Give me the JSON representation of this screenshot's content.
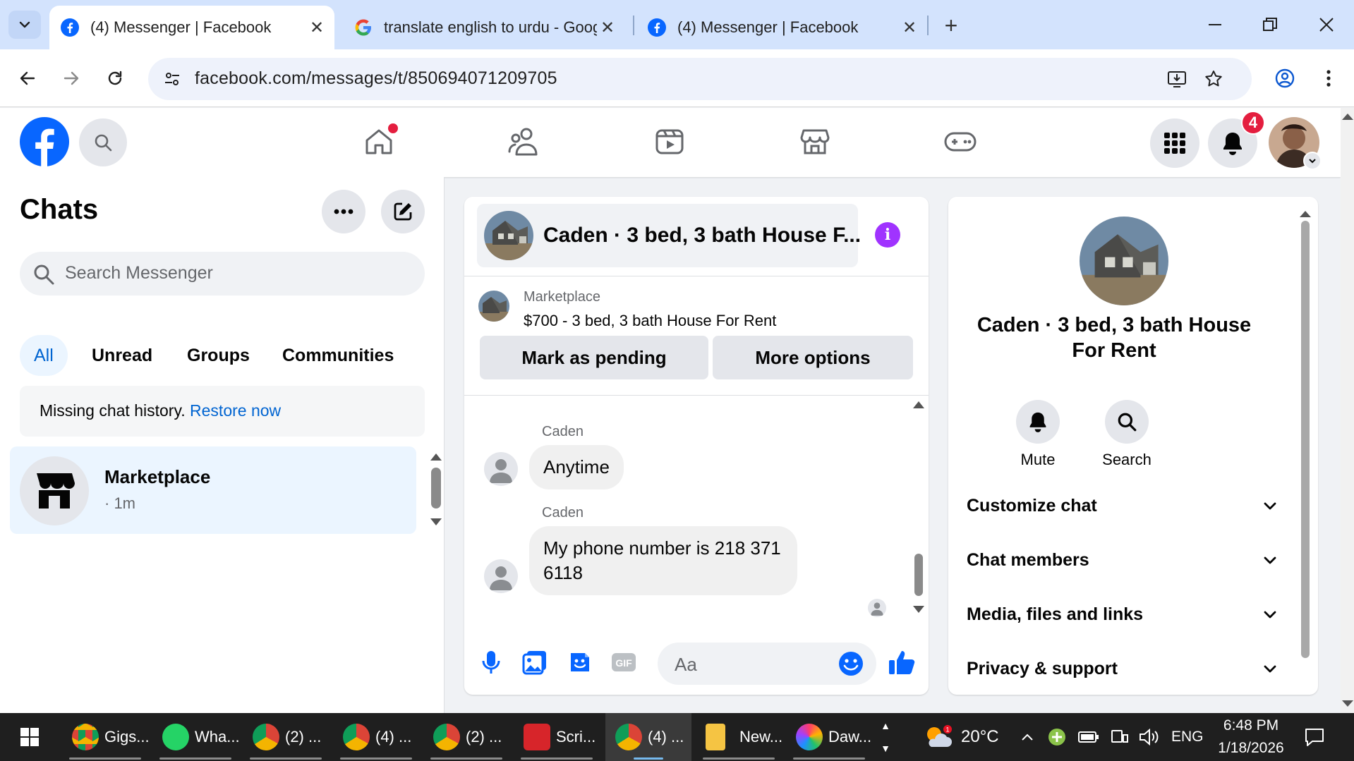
{
  "browser": {
    "tabs": [
      {
        "title": "(4) Messenger | Facebook",
        "favicon": "facebook-icon",
        "active": true
      },
      {
        "title": "translate english to urdu - Goog",
        "favicon": "google-icon",
        "active": false
      },
      {
        "title": "(4) Messenger | Facebook",
        "favicon": "facebook-icon",
        "active": false
      }
    ],
    "url": "facebook.com/messages/t/850694071209705"
  },
  "fb_header": {
    "notification_count": "4",
    "brand_color": "#0866ff"
  },
  "sidebar": {
    "title": "Chats",
    "search_placeholder": "Search Messenger",
    "filters": [
      "All",
      "Unread",
      "Groups",
      "Communities"
    ],
    "history_text": "Missing chat history.",
    "history_link": "Restore now",
    "chats": [
      {
        "name": "Marketplace",
        "time": "· 1m"
      }
    ]
  },
  "conversation": {
    "header_title": "Caden · 3 bed, 3 bath House F...",
    "marketplace_label": "Marketplace",
    "listing_title": "$700 - 3 bed, 3 bath House For Rent",
    "buttons": {
      "pending": "Mark as pending",
      "more": "More options"
    },
    "messages": [
      {
        "sender": "Caden",
        "text": "Anytime"
      },
      {
        "sender": "Caden",
        "text": "My phone number is 218 371 6118"
      }
    ],
    "composer_placeholder": "Aa"
  },
  "right_panel": {
    "title": "Caden · 3 bed, 3 bath House For Rent",
    "actions": [
      "Mute",
      "Search"
    ],
    "sections": [
      "Customize chat",
      "Chat members",
      "Media, files and links",
      "Privacy & support"
    ]
  },
  "taskbar": {
    "apps": [
      {
        "label": "Gigs..."
      },
      {
        "label": "Wha..."
      },
      {
        "label": "(2) ..."
      },
      {
        "label": "(4) ..."
      },
      {
        "label": "(2) ..."
      },
      {
        "label": "Scri..."
      },
      {
        "label": "(4) ..."
      },
      {
        "label": "New..."
      },
      {
        "label": "Daw..."
      }
    ],
    "weather": "20°C",
    "language": "ENG",
    "time": "6:48 PM",
    "date": "1/18/2026"
  }
}
